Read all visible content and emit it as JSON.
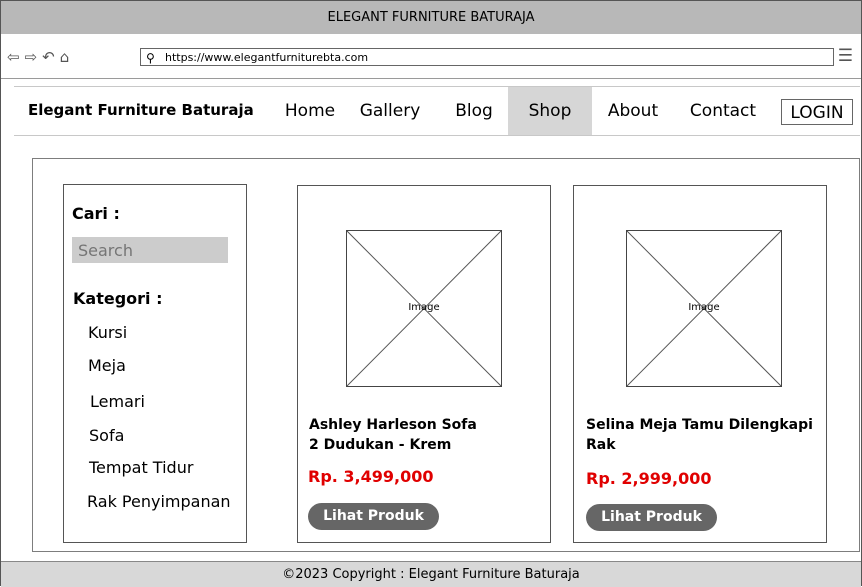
{
  "window": {
    "title": "ELEGANT FURNITURE BATURAJA"
  },
  "browser": {
    "back_icon": "back-arrow",
    "forward_icon": "forward-arrow",
    "reload_icon": "reload",
    "home_icon": "home",
    "url": "https://www.elegantfurniturebta.com",
    "menu_icon": "hamburger"
  },
  "site": {
    "brand": "Elegant Furniture Baturaja",
    "nav": [
      "Home",
      "Gallery",
      "Blog",
      "Shop",
      "About",
      "Contact"
    ],
    "active_nav": "Shop",
    "login_label": "LOGIN"
  },
  "sidebar": {
    "search_title": "Cari :",
    "search_placeholder": "Search",
    "category_title": "Kategori :",
    "categories": [
      "Kursi",
      "Meja",
      "Lemari",
      "Sofa",
      "Tempat Tidur",
      "Rak Penyimpanan"
    ]
  },
  "products": [
    {
      "image_label": "Image",
      "name_line1": "Ashley Harleson Sofa",
      "name_line2": "2 Dudukan - Krem",
      "price": "Rp. 3,499,000",
      "button": "Lihat Produk"
    },
    {
      "image_label": "Image",
      "name_line1": "Selina Meja Tamu Dilengkapi",
      "name_line2": "Rak",
      "price": "Rp. 2,999,000",
      "button": "Lihat Produk"
    }
  ],
  "footer": {
    "copyright": "©2023 Copyright : Elegant Furniture Baturaja"
  },
  "colors": {
    "price": "#e00000",
    "active_nav": "#d6d6d6",
    "button": "#666666"
  }
}
